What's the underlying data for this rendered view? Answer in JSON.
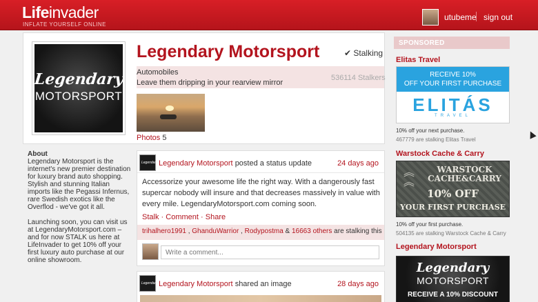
{
  "topbar": {
    "logo_bold": "Life",
    "logo_rest": "invader",
    "tagline": "INFLATE YOURSELF ONLINE",
    "username": "utubeme",
    "signout": "sign out"
  },
  "profile": {
    "name": "Legendary Motorsport",
    "stalking_label": "Stalking",
    "category": "Automobiles",
    "motto": "Leave them dripping in your rearview mirror",
    "stalkers": "536114 Stalkers",
    "photos_label": "Photos",
    "photos_count": "5",
    "logo_script": "Legendary",
    "logo_block": "MOTORSPORT"
  },
  "about": {
    "heading": "About",
    "p1": "Legendary Motorsport is the internet's new premier destination for luxury brand auto shopping. Stylish and stunning Italian imports like the Pegassi Infernus, rare Swedish exotics like the Overflod - we've got it all.",
    "p2": "Launching soon, you can visit us at LegendaryMotorsport.com – and for now STALK us here at LifeInvader to get 10% off your first luxury auto purchase at our online showroom."
  },
  "posts": [
    {
      "author": "Legendary Motorsport",
      "action": "posted a status update",
      "time": "24 days ago",
      "body": "Accessorize your awesome life the right way. With a dangerously fast supercar nobody will insure and that decreases massively in value with every mile. LegendaryMotorsport.com coming soon.",
      "links": [
        "Stalk",
        "Comment",
        "Share"
      ],
      "stalkers": [
        "trihalhero1991",
        "GhanduWarrior",
        "Rodypostma"
      ],
      "others": "16663 others",
      "stalk_suffix": "are stalking this",
      "comment_placeholder": "Write a comment..."
    },
    {
      "author": "Legendary Motorsport",
      "action": "shared an image",
      "time": "28 days ago"
    }
  ],
  "sidebar": {
    "sponsored": "SPONSORED",
    "ads": [
      {
        "title": "Elitas Travel",
        "banner_line1": "RECEIVE 10%",
        "banner_line2": "OFF YOUR FIRST PURCHASE",
        "brand": "ELITÁS",
        "brand_sub": "TRAVEL",
        "caption": "10% off your next purchase.",
        "stalkers": "467779 are stalking Elitas Travel"
      },
      {
        "title": "Warstock Cache & Carry",
        "banner_line1": "WARSTOCK",
        "banner_line2": "CACHE&CARRY",
        "offer_line1": "10% OFF",
        "offer_line2": "YOUR FIRST PURCHASE",
        "caption": "10% off your first purchase.",
        "stalkers": "504135 are stalking Warstock Cache & Carry"
      },
      {
        "title": "Legendary Motorsport",
        "script": "Legendary",
        "block": "MOTORSPORT",
        "offer": "RECEIVE A 10% DISCOUNT"
      }
    ]
  },
  "colors": {
    "brand_red": "#b3141e",
    "topbar_red": "#d81f26",
    "pink_band": "#f4e3e3",
    "elitas_blue": "#2aa3df"
  }
}
